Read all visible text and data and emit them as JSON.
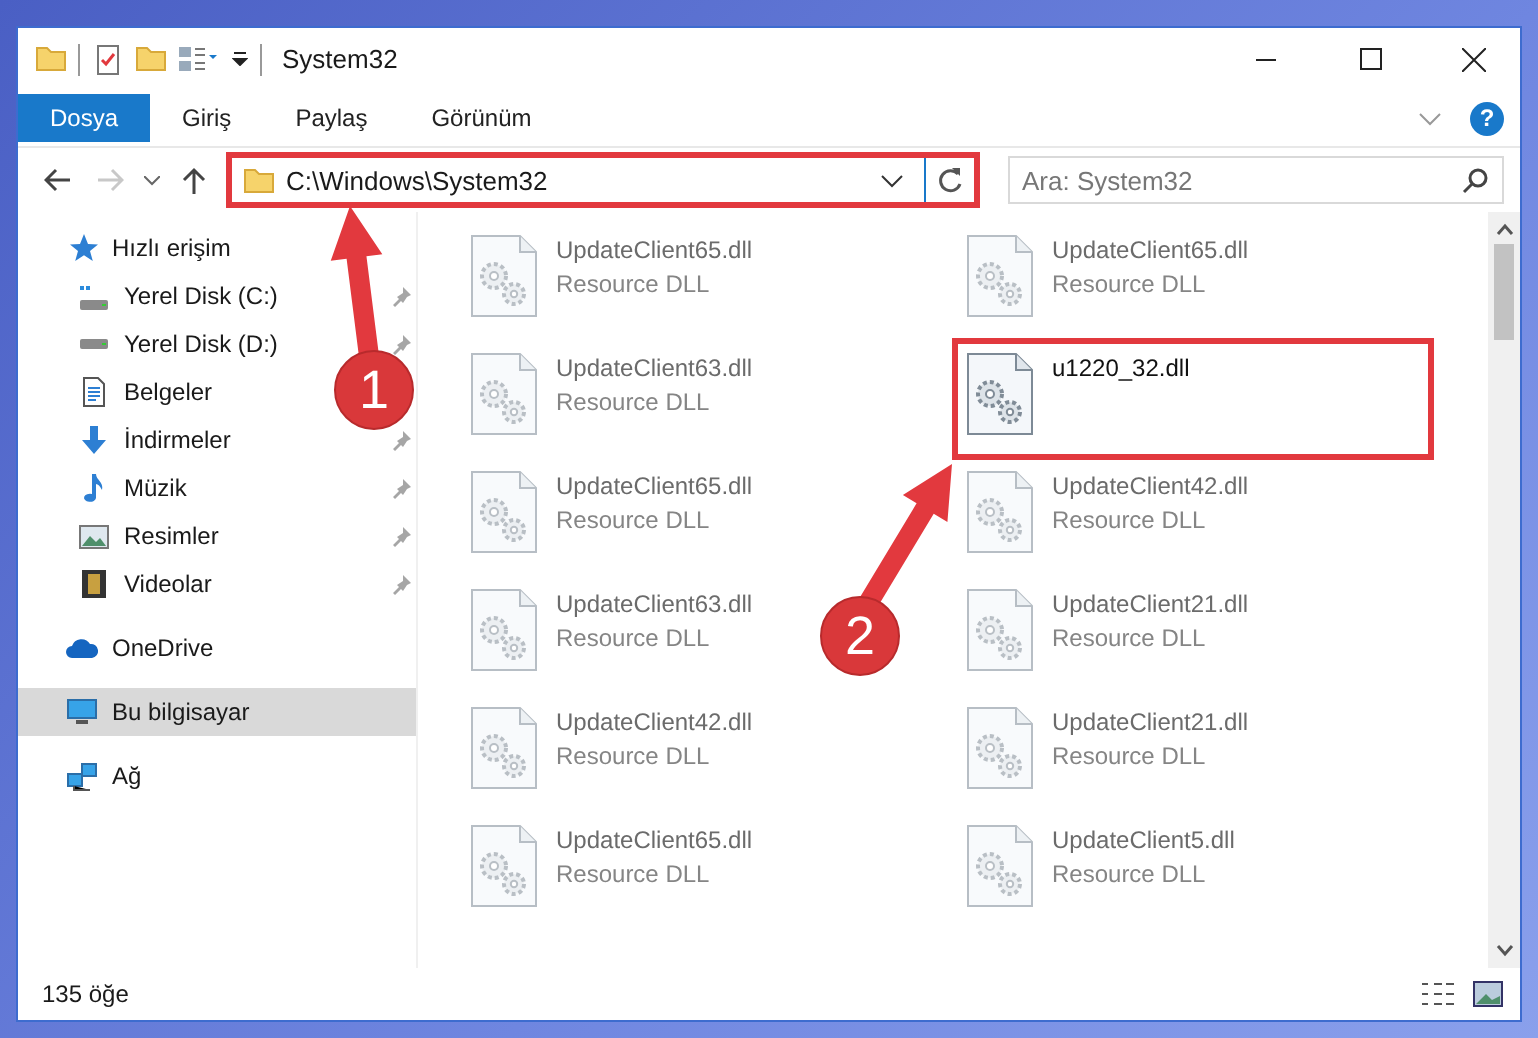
{
  "window": {
    "title": "System32"
  },
  "ribbon": {
    "tabs": [
      {
        "label": "Dosya",
        "selected": true
      },
      {
        "label": "Giriş",
        "selected": false
      },
      {
        "label": "Paylaş",
        "selected": false
      },
      {
        "label": "Görünüm",
        "selected": false
      }
    ],
    "help": "?"
  },
  "address_bar": {
    "path": "C:\\Windows\\System32",
    "highlighted": true
  },
  "search": {
    "placeholder": "Ara: System32"
  },
  "sidebar": {
    "items": [
      {
        "label": "Hızlı erişim",
        "kind": "star",
        "selected": false,
        "children": [
          {
            "label": "Yerel Disk (C:)",
            "kind": "drive-c",
            "pinned": true,
            "selected": false
          },
          {
            "label": "Yerel Disk (D:)",
            "kind": "drive",
            "pinned": true,
            "selected": false
          },
          {
            "label": "Belgeler",
            "kind": "document",
            "selected": false
          },
          {
            "label": "İndirmeler",
            "kind": "download",
            "pinned": true,
            "selected": false
          },
          {
            "label": "Müzik",
            "kind": "music",
            "pinned": true,
            "selected": false
          },
          {
            "label": "Resimler",
            "kind": "pictures",
            "pinned": true,
            "selected": false
          },
          {
            "label": "Videolar",
            "kind": "video",
            "pinned": true,
            "selected": false
          }
        ]
      },
      {
        "label": "OneDrive",
        "kind": "cloud",
        "selected": false
      },
      {
        "label": "Bu bilgisayar",
        "kind": "computer",
        "selected": true
      },
      {
        "label": "Ağ",
        "kind": "network",
        "selected": false
      }
    ]
  },
  "files": [
    {
      "name": "UpdateClient65.dll",
      "type": "Resource DLL",
      "dimmed": true,
      "highlighted": false
    },
    {
      "name": "UpdateClient65.dll",
      "type": "Resource DLL",
      "dimmed": true,
      "highlighted": false
    },
    {
      "name": "UpdateClient63.dll",
      "type": "Resource DLL",
      "dimmed": true,
      "highlighted": false
    },
    {
      "name": "u1220_32.dll",
      "dimmed": false,
      "highlighted": true
    },
    {
      "name": "UpdateClient65.dll",
      "type": "Resource DLL",
      "dimmed": true,
      "highlighted": false
    },
    {
      "name": "UpdateClient42.dll",
      "type": "Resource DLL",
      "dimmed": true,
      "highlighted": false
    },
    {
      "name": "UpdateClient63.dll",
      "type": "Resource DLL",
      "dimmed": true,
      "highlighted": false
    },
    {
      "name": "UpdateClient21.dll",
      "type": "Resource DLL",
      "dimmed": true,
      "highlighted": false
    },
    {
      "name": "UpdateClient42.dll",
      "type": "Resource DLL",
      "dimmed": true,
      "highlighted": false
    },
    {
      "name": "UpdateClient21.dll",
      "type": "Resource DLL",
      "dimmed": true,
      "highlighted": false
    },
    {
      "name": "UpdateClient65.dll",
      "type": "Resource DLL",
      "dimmed": true,
      "highlighted": false
    },
    {
      "name": "UpdateClient5.dll",
      "type": "Resource DLL",
      "dimmed": true,
      "highlighted": false
    }
  ],
  "status_bar": {
    "item_count": "135 öğe"
  },
  "annotations": [
    {
      "number": "1"
    },
    {
      "number": "2"
    }
  ]
}
